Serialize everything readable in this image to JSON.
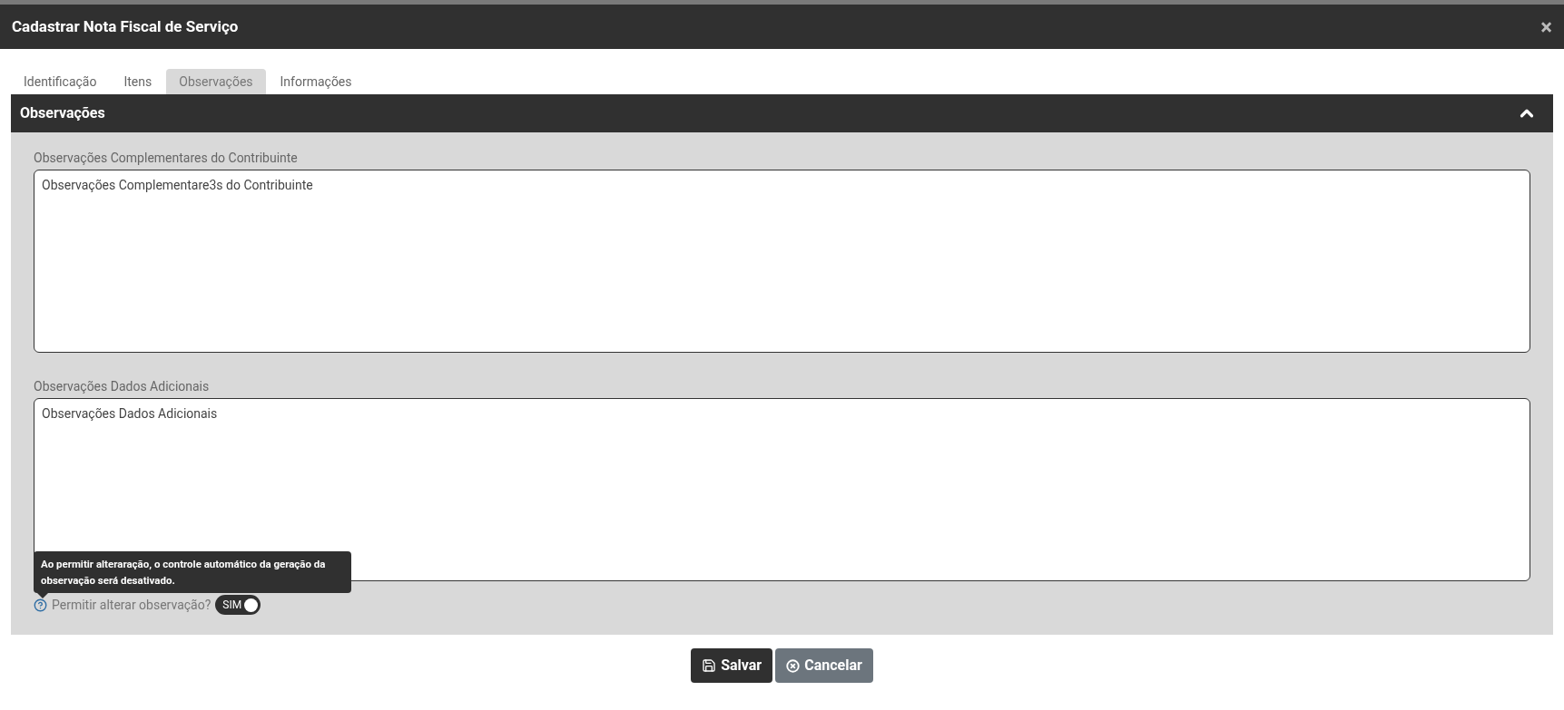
{
  "window": {
    "title": "Cadastrar Nota Fiscal de Serviço",
    "close": "×"
  },
  "tabs": [
    {
      "label": "Identificação",
      "selected": false
    },
    {
      "label": "Itens",
      "selected": false
    },
    {
      "label": "Observações",
      "selected": true
    },
    {
      "label": "Informações",
      "selected": false
    }
  ],
  "section": {
    "title": "Observações",
    "expanded": true
  },
  "fields": [
    {
      "label": "Observações Complementares do Contribuinte",
      "value": "Observações Complementare3s do Contribuinte"
    },
    {
      "label": "Observações Dados Adicionais",
      "value": "Observações Dados Adicionais"
    }
  ],
  "tooltip": "Ao permitir alteraração, o controle automático da geração da observação será desativado.",
  "toggle": {
    "label": "Permitir alterar observação?",
    "on": true,
    "text": "SIM"
  },
  "buttons": [
    {
      "kind": "save",
      "label": "Salvar"
    },
    {
      "kind": "cancel",
      "label": "Cancelar"
    }
  ]
}
